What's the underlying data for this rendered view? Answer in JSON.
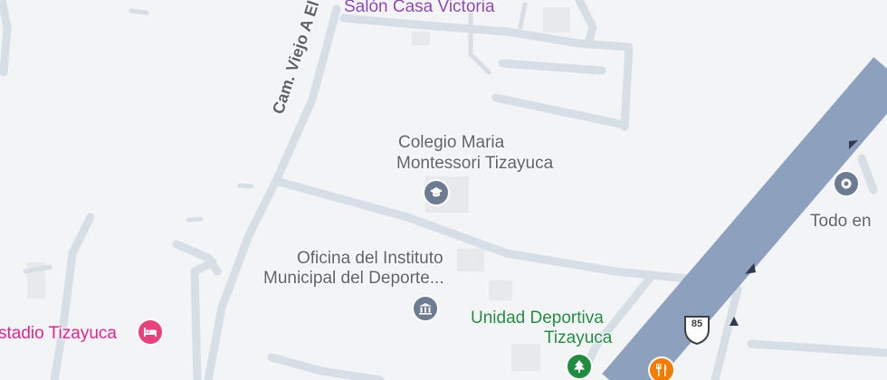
{
  "map": {
    "labels": {
      "salon": "Salón Casa Victoria",
      "road_name": "Cam. Viejo A El",
      "colegio_line1": "Colegio Maria",
      "colegio_line2": "Montessori Tizayuca",
      "oficina_line1": "Oficina del Instituto",
      "oficina_line2": "Municipal del Deporte...",
      "unidad_line1": "Unidad Deportiva",
      "unidad_line2": "Tizayuca",
      "estadio": "stadio Tizayuca",
      "todo": "Todo en",
      "highway_shield": "85"
    },
    "icons": {
      "school": "school-icon",
      "government": "government-building-icon",
      "park": "tree-icon",
      "hotel": "bed-icon",
      "restaurant": "fork-knife-icon",
      "place": "location-pin-icon"
    },
    "colors": {
      "background": "#f3f4f6",
      "road": "#d6dee6",
      "highway": "#8da0bd",
      "label_gray": "#5f6368",
      "label_purple": "#8e44c7",
      "label_green": "#1e8e3e",
      "label_pink": "#e91e8c",
      "school_pin": "#6b7c93",
      "park_pin": "#1e8e3e",
      "hotel_pin": "#ec407a",
      "restaurant_pin": "#f57c00"
    }
  }
}
